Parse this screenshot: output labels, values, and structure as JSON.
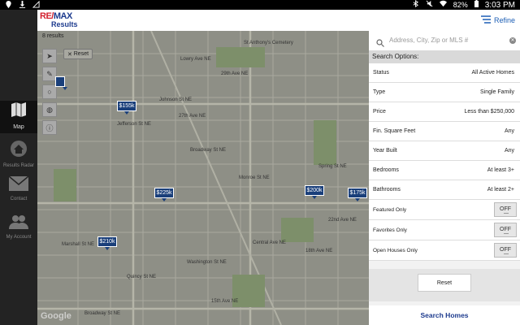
{
  "status_bar": {
    "time": "3:03 PM",
    "battery": "82%",
    "icons": [
      "location-icon",
      "download-icon",
      "signal-icon",
      "bluetooth-icon",
      "mute-icon",
      "wifi-icon"
    ]
  },
  "header": {
    "brand": "RE/MAX",
    "brand_x": "MAX",
    "brand_sub": "Results",
    "refine_label": "Refine"
  },
  "sidebar": {
    "items": [
      {
        "label": "Map",
        "icon": "map-icon"
      },
      {
        "label": "Results Radar",
        "icon": "home-icon"
      },
      {
        "label": "Contact",
        "icon": "mail-icon"
      },
      {
        "label": "My Account",
        "icon": "people-icon"
      }
    ]
  },
  "map": {
    "results_label": "8 results",
    "reset_label": "Reset",
    "pins": [
      "$155k",
      "$225k",
      "$200k",
      "$175k",
      "$210k",
      ""
    ],
    "streets": [
      "St Anthony's Cemetery",
      "Lowry Ave NE",
      "29th Ave NE",
      "27th Ave NE",
      "Broadway St NE",
      "Jefferson St NE",
      "Marshall St NE",
      "Johnson St NE",
      "Washington St NE",
      "Monroe St NE",
      "Central Ave NE",
      "Spring St NE",
      "22nd Ave NE",
      "18th Ave NE",
      "Quincy St NE",
      "15th Ave NE",
      "Broadway St NE"
    ],
    "google_label": "Google"
  },
  "panel": {
    "search_placeholder": "Address, City, Zip or MLS #",
    "options_title": "Search Options:",
    "rows": [
      {
        "key": "Status",
        "value": "All Active Homes"
      },
      {
        "key": "Type",
        "value": "Single Family"
      },
      {
        "key": "Price",
        "value": "Less than $250,000"
      },
      {
        "key": "Fin. Square Feet",
        "value": "Any"
      },
      {
        "key": "Year Built",
        "value": "Any"
      },
      {
        "key": "Bedrooms",
        "value": "At least 3+"
      },
      {
        "key": "Bathrooms",
        "value": "At least 2+"
      }
    ],
    "toggles": [
      {
        "key": "Featured Only",
        "value": "OFF"
      },
      {
        "key": "Favorites Only",
        "value": "OFF"
      },
      {
        "key": "Open Houses Only",
        "value": "OFF"
      }
    ],
    "reset_label": "Reset",
    "search_homes_label": "Search Homes"
  },
  "colors": {
    "brand_red": "#d3212f",
    "brand_blue": "#1d3b8e",
    "pin_blue": "#1a3f7a"
  }
}
